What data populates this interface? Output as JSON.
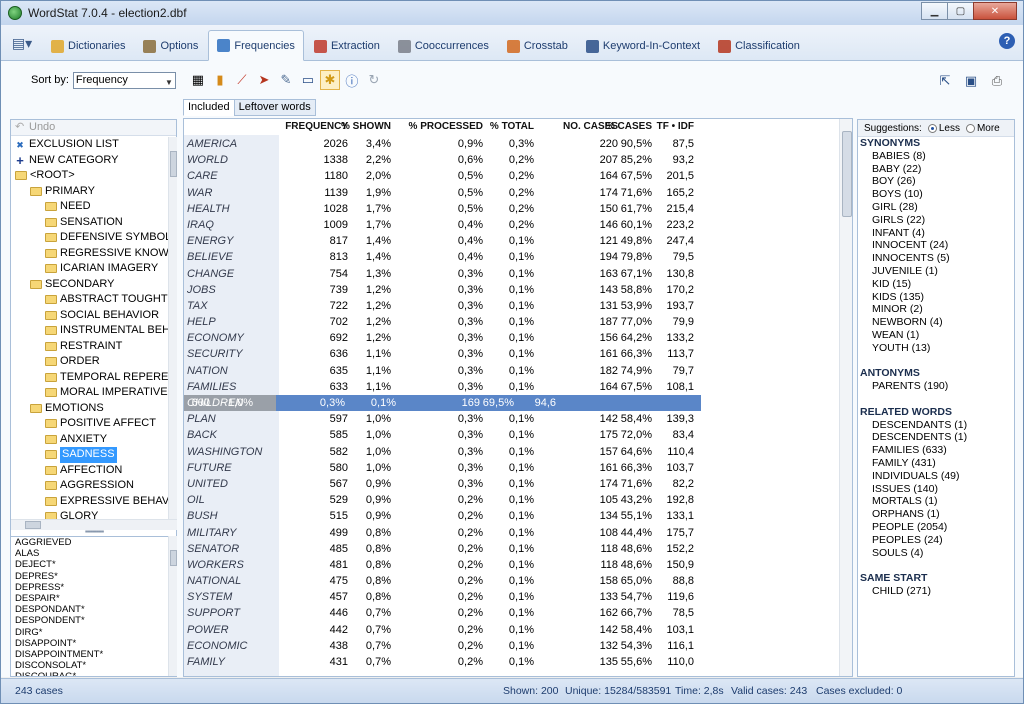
{
  "window": {
    "title": "WordStat 7.0.4 - election2.dbf"
  },
  "tabs": [
    {
      "label": "Dictionaries",
      "icon": "folder-star-icon",
      "active": false
    },
    {
      "label": "Options",
      "icon": "options-icon",
      "active": false
    },
    {
      "label": "Frequencies",
      "icon": "document-lines-icon",
      "active": true
    },
    {
      "label": "Extraction",
      "icon": "extraction-icon",
      "active": false
    },
    {
      "label": "Cooccurrences",
      "icon": "chain-icon",
      "active": false
    },
    {
      "label": "Crosstab",
      "icon": "crosstab-icon",
      "active": false
    },
    {
      "label": "Keyword-In-Context",
      "icon": "grid-icon",
      "active": false
    },
    {
      "label": "Classification",
      "icon": "classification-icon",
      "active": false
    }
  ],
  "toolbar": {
    "sort_label": "Sort by:",
    "sort_value": "Frequency"
  },
  "subtabs": [
    "Included",
    "Leftover words"
  ],
  "left_panel": {
    "undo_label": "Undo",
    "tree": [
      {
        "label": "EXCLUSION LIST",
        "level": 0,
        "type": "exclusion"
      },
      {
        "label": "NEW CATEGORY",
        "level": 0,
        "type": "new"
      },
      {
        "label": "<ROOT>",
        "level": 0,
        "type": "folder"
      },
      {
        "label": "PRIMARY",
        "level": 1,
        "type": "folder"
      },
      {
        "label": "NEED",
        "level": 2,
        "type": "folder"
      },
      {
        "label": "SENSATION",
        "level": 2,
        "type": "folder"
      },
      {
        "label": "DEFENSIVE SYMBOL",
        "level": 2,
        "type": "folder"
      },
      {
        "label": "REGRESSIVE KNOWLEI",
        "level": 2,
        "type": "folder"
      },
      {
        "label": "ICARIAN IMAGERY",
        "level": 2,
        "type": "folder"
      },
      {
        "label": "SECONDARY",
        "level": 1,
        "type": "folder"
      },
      {
        "label": "ABSTRACT TOUGHT",
        "level": 2,
        "type": "folder"
      },
      {
        "label": "SOCIAL BEHAVIOR",
        "level": 2,
        "type": "folder"
      },
      {
        "label": "INSTRUMENTAL BEHA\\",
        "level": 2,
        "type": "folder"
      },
      {
        "label": "RESTRAINT",
        "level": 2,
        "type": "folder"
      },
      {
        "label": "ORDER",
        "level": 2,
        "type": "folder"
      },
      {
        "label": "TEMPORAL REPERE",
        "level": 2,
        "type": "folder"
      },
      {
        "label": "MORAL IMPERATIVE",
        "level": 2,
        "type": "folder"
      },
      {
        "label": "EMOTIONS",
        "level": 1,
        "type": "folder"
      },
      {
        "label": "POSITIVE AFFECT",
        "level": 2,
        "type": "folder"
      },
      {
        "label": "ANXIETY",
        "level": 2,
        "type": "folder"
      },
      {
        "label": "SADNESS",
        "level": 2,
        "type": "folder",
        "selected": true
      },
      {
        "label": "AFFECTION",
        "level": 2,
        "type": "folder"
      },
      {
        "label": "AGGRESSION",
        "level": 2,
        "type": "folder"
      },
      {
        "label": "EXPRESSIVE BEHAVIO",
        "level": 2,
        "type": "folder"
      },
      {
        "label": "GLORY",
        "level": 2,
        "type": "folder"
      }
    ],
    "words": [
      "AGGRIEVED",
      "ALAS",
      "DEJECT*",
      "DEPRES*",
      "DEPRESS*",
      "DESPAIR*",
      "DESPONDANT*",
      "DESPONDENT*",
      "DIRG*",
      "DISAPPOINT*",
      "DISAPPOINTMENT*",
      "DISCONSOLAT*",
      "DISCOURAG*"
    ]
  },
  "table": {
    "headers": [
      "FREQUENCY",
      "% SHOWN",
      "% PROCESSED",
      "% TOTAL",
      "NO. CASES",
      "% CASES",
      "TF • IDF"
    ],
    "selected_index": 16,
    "rows": [
      [
        "AMERICA",
        "2026",
        "3,4%",
        "0,9%",
        "0,3%",
        "220",
        "90,5%",
        "87,5"
      ],
      [
        "WORLD",
        "1338",
        "2,2%",
        "0,6%",
        "0,2%",
        "207",
        "85,2%",
        "93,2"
      ],
      [
        "CARE",
        "1180",
        "2,0%",
        "0,5%",
        "0,2%",
        "164",
        "67,5%",
        "201,5"
      ],
      [
        "WAR",
        "1139",
        "1,9%",
        "0,5%",
        "0,2%",
        "174",
        "71,6%",
        "165,2"
      ],
      [
        "HEALTH",
        "1028",
        "1,7%",
        "0,5%",
        "0,2%",
        "150",
        "61,7%",
        "215,4"
      ],
      [
        "IRAQ",
        "1009",
        "1,7%",
        "0,4%",
        "0,2%",
        "146",
        "60,1%",
        "223,2"
      ],
      [
        "ENERGY",
        "817",
        "1,4%",
        "0,4%",
        "0,1%",
        "121",
        "49,8%",
        "247,4"
      ],
      [
        "BELIEVE",
        "813",
        "1,4%",
        "0,4%",
        "0,1%",
        "194",
        "79,8%",
        "79,5"
      ],
      [
        "CHANGE",
        "754",
        "1,3%",
        "0,3%",
        "0,1%",
        "163",
        "67,1%",
        "130,8"
      ],
      [
        "JOBS",
        "739",
        "1,2%",
        "0,3%",
        "0,1%",
        "143",
        "58,8%",
        "170,2"
      ],
      [
        "TAX",
        "722",
        "1,2%",
        "0,3%",
        "0,1%",
        "131",
        "53,9%",
        "193,7"
      ],
      [
        "HELP",
        "702",
        "1,2%",
        "0,3%",
        "0,1%",
        "187",
        "77,0%",
        "79,9"
      ],
      [
        "ECONOMY",
        "692",
        "1,2%",
        "0,3%",
        "0,1%",
        "156",
        "64,2%",
        "133,2"
      ],
      [
        "SECURITY",
        "636",
        "1,1%",
        "0,3%",
        "0,1%",
        "161",
        "66,3%",
        "113,7"
      ],
      [
        "NATION",
        "635",
        "1,1%",
        "0,3%",
        "0,1%",
        "182",
        "74,9%",
        "79,7"
      ],
      [
        "FAMILIES",
        "633",
        "1,1%",
        "0,3%",
        "0,1%",
        "164",
        "67,5%",
        "108,1"
      ],
      [
        "CHILDREN",
        "600",
        "1,0%",
        "0,3%",
        "0,1%",
        "169",
        "69,5%",
        "94,6"
      ],
      [
        "PLAN",
        "597",
        "1,0%",
        "0,3%",
        "0,1%",
        "142",
        "58,4%",
        "139,3"
      ],
      [
        "BACK",
        "585",
        "1,0%",
        "0,3%",
        "0,1%",
        "175",
        "72,0%",
        "83,4"
      ],
      [
        "WASHINGTON",
        "582",
        "1,0%",
        "0,3%",
        "0,1%",
        "157",
        "64,6%",
        "110,4"
      ],
      [
        "FUTURE",
        "580",
        "1,0%",
        "0,3%",
        "0,1%",
        "161",
        "66,3%",
        "103,7"
      ],
      [
        "UNITED",
        "567",
        "0,9%",
        "0,3%",
        "0,1%",
        "174",
        "71,6%",
        "82,2"
      ],
      [
        "OIL",
        "529",
        "0,9%",
        "0,2%",
        "0,1%",
        "105",
        "43,2%",
        "192,8"
      ],
      [
        "BUSH",
        "515",
        "0,9%",
        "0,2%",
        "0,1%",
        "134",
        "55,1%",
        "133,1"
      ],
      [
        "MILITARY",
        "499",
        "0,8%",
        "0,2%",
        "0,1%",
        "108",
        "44,4%",
        "175,7"
      ],
      [
        "SENATOR",
        "485",
        "0,8%",
        "0,2%",
        "0,1%",
        "118",
        "48,6%",
        "152,2"
      ],
      [
        "WORKERS",
        "481",
        "0,8%",
        "0,2%",
        "0,1%",
        "118",
        "48,6%",
        "150,9"
      ],
      [
        "NATIONAL",
        "475",
        "0,8%",
        "0,2%",
        "0,1%",
        "158",
        "65,0%",
        "88,8"
      ],
      [
        "SYSTEM",
        "457",
        "0,8%",
        "0,2%",
        "0,1%",
        "133",
        "54,7%",
        "119,6"
      ],
      [
        "SUPPORT",
        "446",
        "0,7%",
        "0,2%",
        "0,1%",
        "162",
        "66,7%",
        "78,5"
      ],
      [
        "POWER",
        "442",
        "0,7%",
        "0,2%",
        "0,1%",
        "142",
        "58,4%",
        "103,1"
      ],
      [
        "ECONOMIC",
        "438",
        "0,7%",
        "0,2%",
        "0,1%",
        "132",
        "54,3%",
        "116,1"
      ],
      [
        "FAMILY",
        "431",
        "0,7%",
        "0,2%",
        "0,1%",
        "135",
        "55,6%",
        "110,0"
      ]
    ]
  },
  "suggestions": {
    "label": "Suggestions:",
    "options": [
      "Less",
      "More"
    ],
    "selected": "Less",
    "sections": [
      {
        "title": "SYNONYMS",
        "items": [
          "BABIES (8)",
          "BABY (22)",
          "BOY (26)",
          "BOYS (10)",
          "GIRL (28)",
          "GIRLS (22)",
          "INFANT (4)",
          "INNOCENT (24)",
          "INNOCENTS (5)",
          "JUVENILE (1)",
          "KID (15)",
          "KIDS (135)",
          "MINOR (2)",
          "NEWBORN (4)",
          "WEAN (1)",
          "YOUTH (13)"
        ]
      },
      {
        "title": "ANTONYMS",
        "items": [
          "PARENTS (190)"
        ]
      },
      {
        "title": "RELATED WORDS",
        "items": [
          "DESCENDANTS (1)",
          "DESCENDENTS (1)",
          "FAMILIES (633)",
          "FAMILY (431)",
          "INDIVIDUALS (49)",
          "ISSUES (140)",
          "MORTALS (1)",
          "ORPHANS (1)",
          "PEOPLE (2054)",
          "PEOPLES (24)",
          "SOULS (4)"
        ]
      },
      {
        "title": "SAME START",
        "items": [
          "CHILD (271)"
        ]
      }
    ]
  },
  "status": {
    "cases": "243 cases",
    "shown": "Shown: 200",
    "unique": "Unique: 15284/583591",
    "time": "Time: 2,8s",
    "valid": "Valid cases: 243",
    "excluded": "Cases excluded: 0"
  }
}
